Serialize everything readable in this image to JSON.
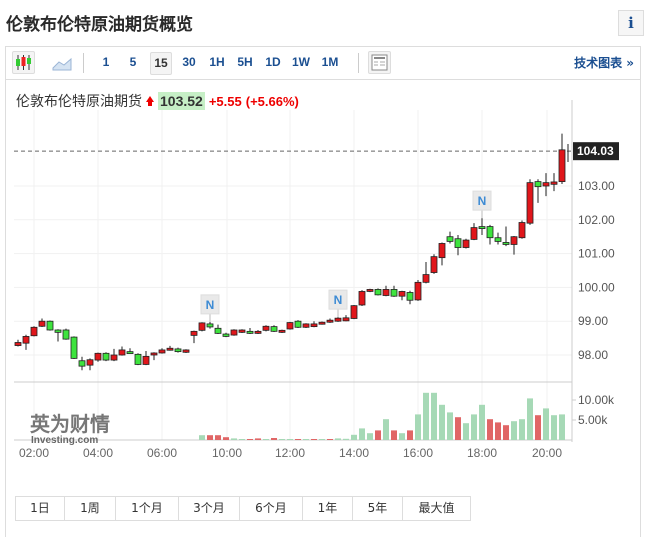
{
  "page": {
    "title": "伦敦布伦特原油期货概览",
    "info_label": "i"
  },
  "toolbar": {
    "chart_types": [
      {
        "icon": "candlestick-icon"
      },
      {
        "icon": "area-chart-icon"
      }
    ],
    "intervals": [
      "1",
      "5",
      "15",
      "30",
      "1H",
      "5H",
      "1D",
      "1W",
      "1M"
    ],
    "selected_interval": "15",
    "layout_icon": "table-layout-icon",
    "tech_chart_label": "技术图表 »"
  },
  "quote": {
    "name": "伦敦布伦特原油期货",
    "price": "103.52",
    "change": "+5.55",
    "change_pct": "(+5.66%)",
    "direction": "up"
  },
  "colors": {
    "up": "#e0161b",
    "down": "#3ee33e",
    "vol_up": "#a6d9b6",
    "vol_down": "#e06666",
    "accent": "#1b4f91"
  },
  "chart_data": {
    "type": "candlestick",
    "interval": "15m",
    "price_axis": {
      "ticks": [
        "98.00",
        "99.00",
        "100.00",
        "101.00",
        "102.00",
        "103.00"
      ],
      "range": [
        97.5,
        104.7
      ]
    },
    "current_price_label": "104.03",
    "current_price": 104.03,
    "time_axis": {
      "ticks": [
        "02:00",
        "04:00",
        "06:00",
        "10:00",
        "12:00",
        "14:00",
        "16:00",
        "18:00",
        "20:00"
      ]
    },
    "volume_axis": {
      "ticks": [
        "10.00k",
        "5.00k"
      ]
    },
    "news_markers": [
      {
        "label": "N",
        "candle": 24
      },
      {
        "label": "N",
        "candle": 40
      },
      {
        "label": "N",
        "candle": 58
      }
    ],
    "candles_ohlc": [
      [
        98.28,
        98.45,
        98.25,
        98.37
      ],
      [
        98.35,
        98.6,
        98.15,
        98.55
      ],
      [
        98.57,
        98.85,
        98.55,
        98.82
      ],
      [
        98.85,
        99.08,
        98.83,
        99.0
      ],
      [
        99.0,
        99.02,
        98.72,
        98.74
      ],
      [
        98.74,
        98.76,
        98.4,
        98.67
      ],
      [
        98.74,
        98.78,
        98.45,
        98.47
      ],
      [
        98.53,
        98.55,
        97.88,
        97.9
      ],
      [
        97.83,
        97.95,
        97.55,
        97.67
      ],
      [
        97.7,
        97.9,
        97.55,
        97.86
      ],
      [
        97.85,
        98.07,
        97.8,
        98.05
      ],
      [
        98.05,
        98.08,
        97.82,
        97.85
      ],
      [
        97.85,
        98.18,
        97.82,
        98.0
      ],
      [
        98.0,
        98.25,
        97.98,
        98.15
      ],
      [
        98.1,
        98.2,
        98.03,
        98.05
      ],
      [
        98.02,
        98.05,
        97.7,
        97.72
      ],
      [
        97.72,
        98.12,
        97.7,
        97.96
      ],
      [
        98.0,
        98.08,
        97.85,
        98.06
      ],
      [
        98.06,
        98.2,
        98.04,
        98.15
      ],
      [
        98.15,
        98.27,
        98.13,
        98.2
      ],
      [
        98.18,
        98.22,
        98.07,
        98.1
      ],
      [
        98.08,
        98.17,
        98.06,
        98.15
      ],
      [
        98.58,
        98.72,
        98.35,
        98.7
      ],
      [
        98.73,
        98.97,
        98.7,
        98.95
      ],
      [
        98.92,
        98.98,
        98.78,
        98.83
      ],
      [
        98.79,
        98.9,
        98.62,
        98.64
      ],
      [
        98.62,
        98.66,
        98.53,
        98.55
      ],
      [
        98.59,
        98.76,
        98.57,
        98.74
      ],
      [
        98.67,
        98.76,
        98.65,
        98.74
      ],
      [
        98.7,
        98.8,
        98.62,
        98.64
      ],
      [
        98.64,
        98.74,
        98.62,
        98.7
      ],
      [
        98.73,
        98.88,
        98.7,
        98.85
      ],
      [
        98.84,
        98.88,
        98.68,
        98.7
      ],
      [
        98.67,
        98.75,
        98.65,
        98.73
      ],
      [
        98.77,
        98.98,
        98.75,
        98.96
      ],
      [
        99.0,
        99.03,
        98.8,
        98.82
      ],
      [
        98.82,
        98.94,
        98.8,
        98.92
      ],
      [
        98.84,
        99.0,
        98.82,
        98.92
      ],
      [
        98.92,
        98.99,
        98.9,
        98.97
      ],
      [
        98.97,
        99.08,
        98.95,
        99.03
      ],
      [
        99.0,
        99.12,
        98.98,
        99.09
      ],
      [
        99.01,
        99.18,
        99.0,
        99.1
      ],
      [
        99.08,
        99.48,
        99.06,
        99.46
      ],
      [
        99.48,
        99.92,
        99.45,
        99.88
      ],
      [
        99.88,
        99.96,
        99.86,
        99.94
      ],
      [
        99.94,
        99.97,
        99.76,
        99.78
      ],
      [
        99.76,
        100.05,
        99.74,
        99.94
      ],
      [
        99.94,
        100.05,
        99.72,
        99.74
      ],
      [
        99.74,
        99.9,
        99.62,
        99.88
      ],
      [
        99.85,
        99.9,
        99.5,
        99.62
      ],
      [
        99.63,
        100.22,
        99.6,
        100.15
      ],
      [
        100.15,
        100.75,
        100.12,
        100.38
      ],
      [
        100.44,
        100.98,
        100.4,
        100.91
      ],
      [
        100.88,
        101.33,
        100.65,
        101.3
      ],
      [
        101.5,
        101.65,
        101.3,
        101.36
      ],
      [
        101.44,
        101.55,
        100.95,
        101.18
      ],
      [
        101.18,
        101.44,
        101.15,
        101.4
      ],
      [
        101.42,
        101.9,
        101.4,
        101.77
      ],
      [
        101.8,
        102.05,
        101.55,
        101.74
      ],
      [
        101.8,
        101.85,
        101.27,
        101.47
      ],
      [
        101.47,
        101.62,
        101.27,
        101.36
      ],
      [
        101.33,
        101.8,
        101.22,
        101.27
      ],
      [
        101.27,
        101.52,
        100.97,
        101.5
      ],
      [
        101.47,
        101.98,
        101.44,
        101.92
      ],
      [
        101.9,
        103.2,
        101.85,
        103.1
      ],
      [
        103.13,
        103.2,
        102.5,
        102.98
      ],
      [
        103.0,
        103.38,
        102.7,
        103.1
      ],
      [
        103.05,
        103.38,
        102.85,
        103.12
      ],
      [
        103.13,
        104.55,
        103.06,
        104.07
      ]
    ],
    "volume_start_candle": 23,
    "volumes_k": [
      1.2,
      1.2,
      1.2,
      0.7,
      0.4,
      0.25,
      0.25,
      0.4,
      0.2,
      0.5,
      0.25,
      0.25,
      0.2,
      0.1,
      0.2,
      0.1,
      0.2,
      0.4,
      0.3,
      1.3,
      2.9,
      1.7,
      2.4,
      5.2,
      2.4,
      1.7,
      2.4,
      6.4,
      11.8,
      11.8,
      8.8,
      6.9,
      5.7,
      4.2,
      6.4,
      8.8,
      5.2,
      4.4,
      3.7,
      4.7,
      5.2,
      10.4,
      6.2,
      7.9,
      6.2,
      6.4
    ],
    "volume_colors": "uddduudduduudududuuuuudududuuuuuduuudddu uudu uu"
  },
  "watermark": {
    "cn": "英为财情",
    "en": "Investing.com"
  },
  "ranges": [
    "1日",
    "1周",
    "1个月",
    "3个月",
    "6个月",
    "1年",
    "5年",
    "最大值"
  ]
}
